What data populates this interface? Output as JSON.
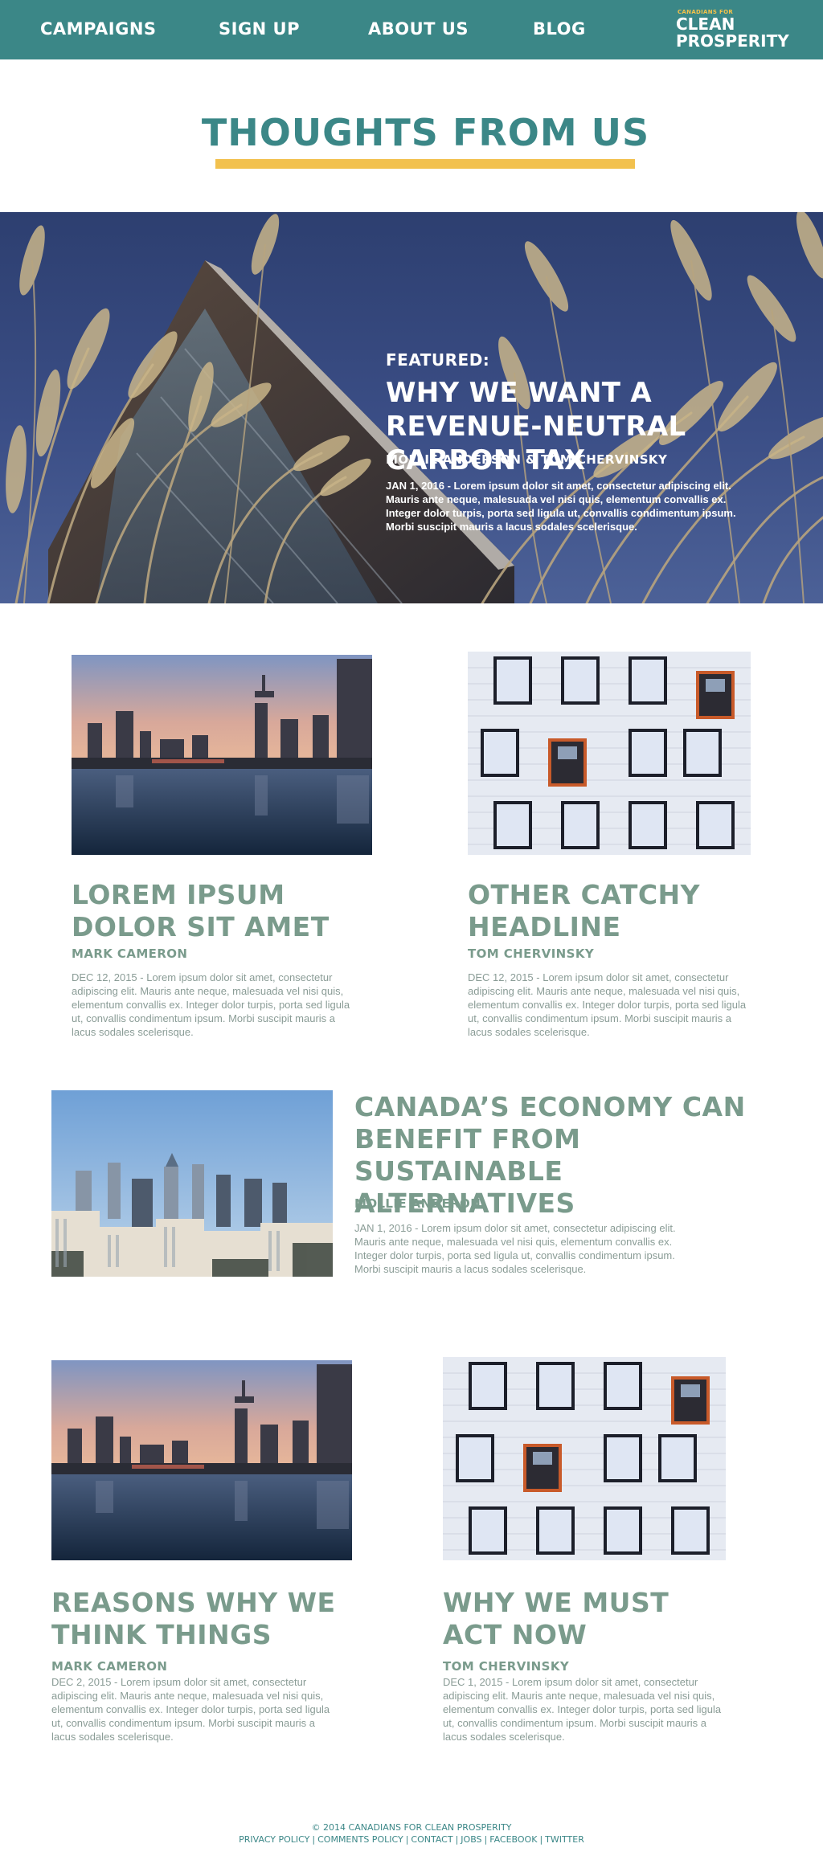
{
  "nav": {
    "items": [
      {
        "label": "CAMPAIGNS"
      },
      {
        "label": "SIGN UP"
      },
      {
        "label": "ABOUT US"
      },
      {
        "label": "BLOG"
      }
    ],
    "logo_small": "CANADIANS FOR",
    "logo_line1": "CLEAN",
    "logo_line2": "PROSPERITY"
  },
  "page_title": "THOUGHTS FROM US",
  "featured": {
    "label": "FEATURED:",
    "title": "WHY WE WANT A REVENUE-NEUTRAL CARBON TAX",
    "authors": "MOLLIE ANDERSON & TOM CHERVINSKY",
    "excerpt": "JAN 1, 2016 - Lorem ipsum dolor sit amet, consectetur adipiscing elit. Mauris ante neque, malesuada vel nisi quis, elementum convallis ex. Integer dolor turpis, porta sed ligula ut, convallis condimentum ipsum. Morbi suscipit mauris a lacus sodales scelerisque."
  },
  "articles": [
    {
      "title": "LOREM IPSUM DOLOR SIT AMET",
      "author": "MARK CAMERON",
      "excerpt": "DEC 12, 2015 - Lorem ipsum dolor sit amet, consectetur adipiscing elit. Mauris ante neque, malesuada vel nisi quis, elementum convallis ex. Integer dolor turpis, porta sed ligula ut, convallis condimentum ipsum. Morbi suscipit mauris a lacus sodales scelerisque."
    },
    {
      "title": "OTHER CATCHY HEADLINE",
      "author": "TOM CHERVINSKY",
      "excerpt": "DEC 12, 2015 - Lorem ipsum dolor sit amet, consectetur adipiscing elit. Mauris ante neque, malesuada vel nisi quis, elementum convallis ex. Integer dolor turpis, porta sed ligula ut, convallis condimentum ipsum. Morbi suscipit mauris a lacus sodales scelerisque."
    },
    {
      "title": "CANADA’S ECONOMY CAN BENEFIT FROM SUSTAINABLE ALTERNATIVES",
      "author": "MOLLIE ANDERON",
      "excerpt": "JAN 1, 2016 - Lorem ipsum dolor sit amet, consectetur adipiscing elit. Mauris ante neque, malesuada vel nisi quis, elementum convallis ex. Integer dolor turpis, porta sed ligula ut, convallis condimentum ipsum. Morbi suscipit mauris a lacus sodales scelerisque."
    },
    {
      "title": "REASONS WHY WE THINK THINGS",
      "author": "MARK CAMERON",
      "excerpt": "DEC 2, 2015 - Lorem ipsum dolor sit amet, consectetur adipiscing elit. Mauris ante neque, malesuada vel nisi quis, elementum convallis ex. Integer dolor turpis, porta sed ligula ut, convallis condimentum ipsum. Morbi suscipit mauris a lacus sodales scelerisque."
    },
    {
      "title": "WHY WE MUST ACT NOW",
      "author": "TOM CHERVINSKY",
      "excerpt": "DEC 1, 2015 - Lorem ipsum dolor sit amet, consectetur adipiscing elit. Mauris ante neque, malesuada vel nisi quis, elementum convallis ex. Integer dolor turpis, porta sed ligula ut, convallis condimentum ipsum. Morbi suscipit mauris a lacus sodales scelerisque."
    }
  ],
  "footer": {
    "copyright": "© 2014 CANADIANS FOR CLEAN PROSPERITY",
    "links": [
      {
        "label": "PRIVACY POLICY"
      },
      {
        "label": "COMMENTS POLICY"
      },
      {
        "label": "CONTACT"
      },
      {
        "label": "JOBS"
      },
      {
        "label": "FACEBOOK"
      },
      {
        "label": "TWITTER"
      }
    ]
  },
  "colors": {
    "nav_bg": "#3b8787",
    "title": "#3b8787",
    "underline": "#f2c14e",
    "card_heading": "#7a9b8c",
    "hero_sky": "#34467a"
  }
}
